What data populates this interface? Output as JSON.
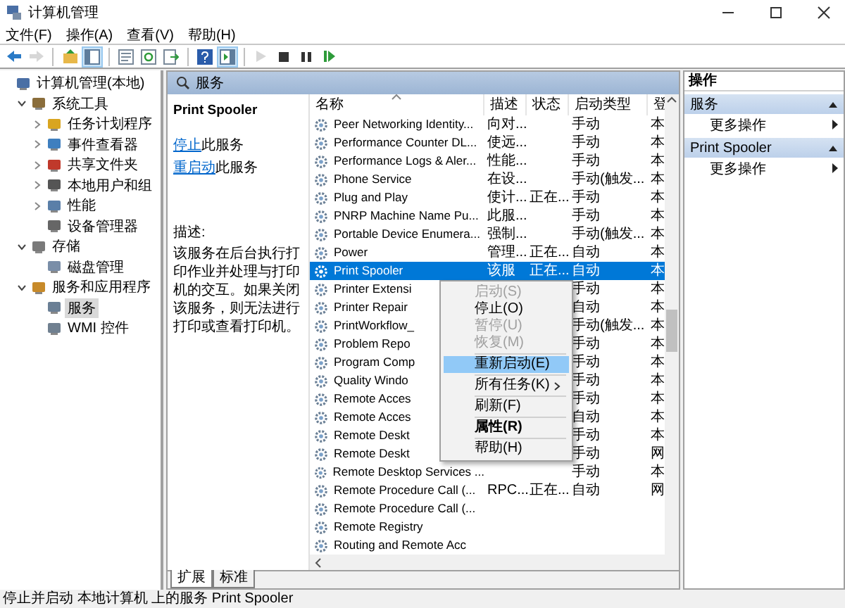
{
  "window": {
    "title": "计算机管理"
  },
  "menu": [
    "文件(F)",
    "操作(A)",
    "查看(V)",
    "帮助(H)"
  ],
  "toolbar": [
    {
      "kind": "back",
      "disabled": false,
      "pressed": false
    },
    {
      "kind": "forward",
      "disabled": true,
      "pressed": false
    },
    {
      "kind": "separator"
    },
    {
      "kind": "up",
      "disabled": false,
      "pressed": false
    },
    {
      "kind": "tree",
      "disabled": false,
      "pressed": true
    },
    {
      "kind": "separator"
    },
    {
      "kind": "properties",
      "disabled": false,
      "pressed": false
    },
    {
      "kind": "refresh",
      "disabled": false,
      "pressed": false
    },
    {
      "kind": "export",
      "disabled": false,
      "pressed": false
    },
    {
      "kind": "separator"
    },
    {
      "kind": "help",
      "disabled": false,
      "pressed": false
    },
    {
      "kind": "pane",
      "disabled": false,
      "pressed": true
    },
    {
      "kind": "separator"
    },
    {
      "kind": "play",
      "disabled": true,
      "pressed": false
    },
    {
      "kind": "stop",
      "disabled": false,
      "pressed": false
    },
    {
      "kind": "pause",
      "disabled": false,
      "pressed": false
    },
    {
      "kind": "resume",
      "disabled": false,
      "pressed": false
    }
  ],
  "tree": [
    {
      "label": "计算机管理(本地)",
      "selected": false,
      "children": [
        {
          "label": "系统工具",
          "selected": false,
          "expanded": true,
          "children": [
            {
              "label": "任务计划程序",
              "selected": false,
              "expanded": false
            },
            {
              "label": "事件查看器",
              "selected": false,
              "expanded": false
            },
            {
              "label": "共享文件夹",
              "selected": false,
              "expanded": false
            },
            {
              "label": "本地用户和组",
              "selected": false,
              "expanded": false
            },
            {
              "label": "性能",
              "selected": false,
              "expanded": false
            },
            {
              "label": "设备管理器",
              "selected": false
            }
          ]
        },
        {
          "label": "存储",
          "selected": false,
          "expanded": true,
          "children": [
            {
              "label": "磁盘管理",
              "selected": false
            }
          ]
        },
        {
          "label": "服务和应用程序",
          "selected": false,
          "expanded": true,
          "children": [
            {
              "label": "服务",
              "selected": true
            },
            {
              "label": "WMI 控件",
              "selected": false
            }
          ]
        }
      ]
    }
  ],
  "content_header": "服务",
  "detail": {
    "title": "Print Spooler",
    "actions": [
      {
        "link": "停止",
        "text": "此服务"
      },
      {
        "link": "重启动",
        "text": "此服务"
      }
    ],
    "description_label": "描述:",
    "description": "该服务在后台执行打印作业并处理与打印机的交互。如果关闭该服务，则无法进行打印或查看打印机。"
  },
  "table": {
    "columns": [
      "名称",
      "描述",
      "状态",
      "启动类型",
      "登"
    ],
    "rows": [
      {
        "name": "Peer Networking Identity...",
        "description": "向对...",
        "startup": "手动",
        "column_5": "本",
        "selected": false
      },
      {
        "name": "Performance Counter DL...",
        "description": "使远...",
        "startup": "手动",
        "column_5": "本",
        "selected": false
      },
      {
        "name": "Performance Logs & Aler...",
        "description": "性能...",
        "startup": "手动",
        "column_5": "本",
        "selected": false
      },
      {
        "name": "Phone Service",
        "description": "在设...",
        "startup": "手动(触发...",
        "column_5": "本",
        "selected": false
      },
      {
        "name": "Plug and Play",
        "description": "使计...",
        "status": "正在...",
        "startup": "手动",
        "column_5": "本",
        "selected": false
      },
      {
        "name": "PNRP Machine Name Pu...",
        "description": "此服...",
        "startup": "手动",
        "column_5": "本",
        "selected": false
      },
      {
        "name": "Portable Device Enumera...",
        "description": "强制...",
        "startup": "手动(触发...",
        "column_5": "本",
        "selected": false
      },
      {
        "name": "Power",
        "description": "管理...",
        "status": "正在...",
        "startup": "自动",
        "column_5": "本",
        "selected": false
      },
      {
        "name": "Print Spooler",
        "description": "该服",
        "status": "正在...",
        "startup": "自动",
        "column_5": "本",
        "selected": true
      },
      {
        "name": "Printer Extensi",
        "startup": "手动",
        "column_5": "本",
        "selected": false
      },
      {
        "name": "Printer Repair",
        "startup": "自动",
        "column_5": "本",
        "selected": false
      },
      {
        "name": "PrintWorkflow_",
        "startup": "手动(触发...",
        "column_5": "本",
        "selected": false
      },
      {
        "name": "Problem Repo",
        "startup": "手动",
        "column_5": "本",
        "selected": false
      },
      {
        "name": "Program Comp",
        "startup": "手动",
        "column_5": "本",
        "selected": false
      },
      {
        "name": "Quality Windo",
        "startup": "手动",
        "column_5": "本",
        "selected": false
      },
      {
        "name": "Remote Acces",
        "startup": "手动",
        "column_5": "本",
        "selected": false
      },
      {
        "name": "Remote Acces",
        "startup": "自动",
        "column_5": "本",
        "selected": false
      },
      {
        "name": "Remote Deskt",
        "startup": "手动",
        "column_5": "本",
        "selected": false
      },
      {
        "name": "Remote Deskt",
        "startup": "手动",
        "column_5": "网",
        "selected": false
      },
      {
        "name": "Remote Desktop Services ...",
        "startup": "手动",
        "column_5": "本",
        "selected": false
      },
      {
        "name": "Remote Procedure Call (...",
        "description": "RPC...",
        "status": "正在...",
        "startup": "自动",
        "column_5": "网",
        "selected": false
      },
      {
        "name": "Remote Procedure Call (...",
        "selected": false
      },
      {
        "name": "Remote Registry",
        "selected": false
      },
      {
        "name": "Routing and Remote Acc",
        "selected": false
      }
    ]
  },
  "context_menu": [
    {
      "kind": "item",
      "label": "启动(S)",
      "disabled": true,
      "highlighted": false,
      "bold": false,
      "submenu": false
    },
    {
      "kind": "item",
      "label": "停止(O)",
      "disabled": false,
      "highlighted": false,
      "bold": false,
      "submenu": false
    },
    {
      "kind": "item",
      "label": "暂停(U)",
      "disabled": true,
      "highlighted": false,
      "bold": false,
      "submenu": false
    },
    {
      "kind": "item",
      "label": "恢复(M)",
      "disabled": true,
      "highlighted": false,
      "bold": false,
      "submenu": false
    },
    {
      "kind": "separator"
    },
    {
      "kind": "item",
      "label": "重新启动(E)",
      "disabled": false,
      "highlighted": true,
      "bold": false,
      "submenu": false
    },
    {
      "kind": "separator"
    },
    {
      "kind": "item",
      "label": "所有任务(K)",
      "disabled": false,
      "highlighted": false,
      "bold": false,
      "submenu": true
    },
    {
      "kind": "separator"
    },
    {
      "kind": "item",
      "label": "刷新(F)",
      "disabled": false,
      "highlighted": false,
      "bold": false,
      "submenu": false
    },
    {
      "kind": "separator"
    },
    {
      "kind": "item",
      "label": "属性(R)",
      "disabled": false,
      "highlighted": false,
      "bold": true,
      "submenu": false
    },
    {
      "kind": "separator"
    },
    {
      "kind": "item",
      "label": "帮助(H)",
      "disabled": false,
      "highlighted": false,
      "bold": false,
      "submenu": false
    }
  ],
  "view_tabs": [
    {
      "label": "扩展",
      "selected": true
    },
    {
      "label": "标准",
      "selected": false
    }
  ],
  "actions_pane": {
    "title": "操作",
    "sections": [
      {
        "title": "服务",
        "items": [
          "更多操作"
        ]
      },
      {
        "title": "Print Spooler",
        "items": [
          "更多操作"
        ]
      }
    ]
  },
  "status_bar": "停止并启动 本地计算机 上的服务 Print Spooler"
}
